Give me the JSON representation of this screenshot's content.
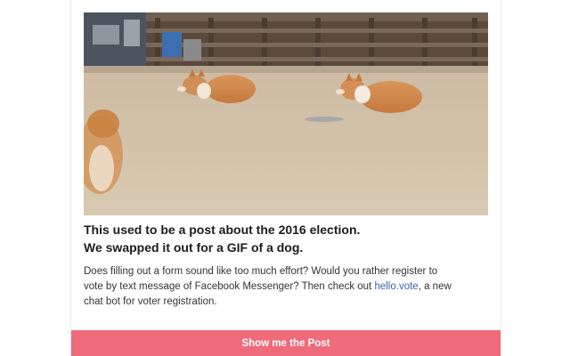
{
  "post": {
    "headline_line1": "This used to be a post about the 2016 election.",
    "headline_line2": "We swapped it out for a GIF of a dog.",
    "body_before_link": "Does filling out a form sound like too much effort? Would you rather register to vote by text message of Facebook Messenger? Then check out ",
    "link_text": "hello.vote",
    "body_after_link": ", a new chat bot for voter registration.",
    "cta_label": "Show me the Post"
  },
  "colors": {
    "cta_background": "#ef6b7b",
    "link": "#3a64b2"
  }
}
